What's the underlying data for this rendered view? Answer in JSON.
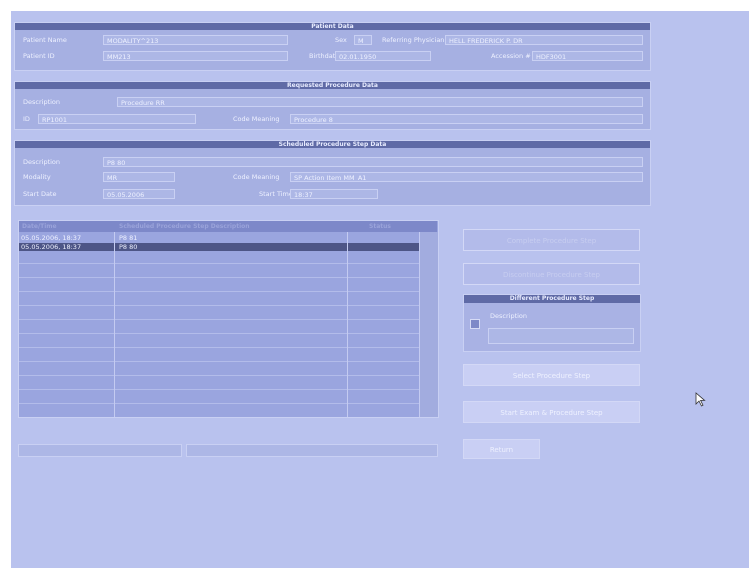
{
  "patient": {
    "title": "Patient Data",
    "name_label": "Patient Name",
    "name_value": "MODALITY^213",
    "sex_label": "Sex",
    "sex_value": "M",
    "ref_label": "Referring Physician",
    "ref_value": "HELL FREDERICK P. DR",
    "id_label": "Patient ID",
    "id_value": "MM213",
    "bd_label": "Birthdate",
    "bd_value": "02.01.1950",
    "acc_label": "Accession #",
    "acc_value": "HDF3001"
  },
  "requested": {
    "title": "Requested Procedure Data",
    "desc_label": "Description",
    "desc_value": "Procedure RR",
    "id_label": "ID",
    "id_value": "RP1001",
    "code_label": "Code Meaning",
    "code_value": "Procedure 8"
  },
  "scheduled": {
    "title": "Scheduled Procedure Step Data",
    "desc_label": "Description",
    "desc_value": "P8 80",
    "mod_label": "Modality",
    "mod_value": "MR",
    "code_label": "Code Meaning",
    "code_value": "SP Action Item MM_A1",
    "sd_label": "Start Date",
    "sd_value": "05.05.2006",
    "st_label": "Start Time",
    "st_value": "18:37"
  },
  "table": {
    "headers": [
      "Date/Time",
      "Scheduled Procedure Step Description",
      "Status"
    ],
    "rows": [
      {
        "datetime": "05.05.2006, 18:37",
        "description": "P8 81",
        "status": ""
      },
      {
        "datetime": "05.05.2006, 18:37",
        "description": "P8 80",
        "status": ""
      }
    ]
  },
  "buttons": {
    "complete": "Complete Procedure Step",
    "discontinue": "Discontinue Procedure Step",
    "different_title": "Different Procedure Step",
    "different_desc_label": "Description",
    "different_desc_value": "",
    "select": "Select Procedure Step",
    "start_exam": "Start Exam & Procedure Step",
    "return": "Return"
  },
  "status_bar": {
    "left": "",
    "right": ""
  }
}
